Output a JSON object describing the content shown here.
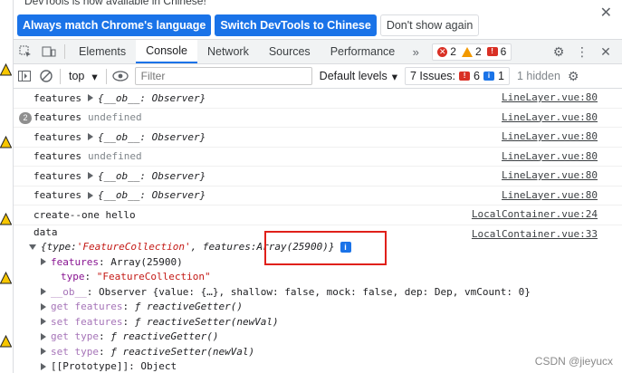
{
  "infobar": {
    "message": "DevTools is now available in Chinese!",
    "buttons": [
      "Always match Chrome's language",
      "Switch DevTools to Chinese",
      "Don't show again"
    ],
    "close_glyph": "✕"
  },
  "tabbar": {
    "tabs": [
      "Elements",
      "Console",
      "Network",
      "Sources",
      "Performance"
    ],
    "active_tab": "Console",
    "more_glyph": "»",
    "error_count": "2",
    "warning_count": "2",
    "issue_count": "6"
  },
  "console_toolbar": {
    "context": "top",
    "filter_placeholder": "Filter",
    "levels_label": "Default levels",
    "issues_label": "7 Issues:",
    "issues_error_count": "6",
    "issues_info_count": "1",
    "hidden_label": "1 hidden"
  },
  "messages": [
    {
      "label": "features",
      "value": "{__ob__: Observer}",
      "source": "LineLayer.vue:80",
      "expandable": true
    },
    {
      "label": "features",
      "value": "undefined",
      "source": "LineLayer.vue:80",
      "repeat": "2",
      "expandable": false
    },
    {
      "label": "features",
      "value": "{__ob__: Observer}",
      "source": "LineLayer.vue:80",
      "expandable": true
    },
    {
      "label": "features",
      "value": "undefined",
      "source": "LineLayer.vue:80",
      "expandable": false
    },
    {
      "label": "features",
      "value": "{__ob__: Observer}",
      "source": "LineLayer.vue:80",
      "expandable": true
    },
    {
      "label": "features",
      "value": "{__ob__: Observer}",
      "source": "LineLayer.vue:80",
      "expandable": true
    },
    {
      "label": "create--one hello",
      "value": "",
      "source": "LocalContainer.vue:24",
      "expandable": false
    }
  ],
  "data_block": {
    "label": "data",
    "source": "LocalContainer.vue:33",
    "summary_prefix": "{type: ",
    "summary_type": "'FeatureCollection'",
    "summary_mid": ", features: ",
    "summary_features": "Array(25900)",
    "summary_suffix": "}",
    "info_glyph": "i",
    "properties": [
      {
        "key": "features",
        "value": "Array(25900)",
        "kind": "expandable"
      },
      {
        "key": "type",
        "value": "\"FeatureCollection\"",
        "kind": "string"
      },
      {
        "key": "__ob__",
        "value": "Observer {value: {…}, shallow: false, mock: false, dep: Dep, vmCount: 0}",
        "kind": "expandable-dim"
      },
      {
        "key": "get features",
        "value": "ƒ reactiveGetter()",
        "kind": "accessor"
      },
      {
        "key": "set features",
        "value": "ƒ reactiveSetter(newVal)",
        "kind": "accessor"
      },
      {
        "key": "get type",
        "value": "ƒ reactiveGetter()",
        "kind": "accessor"
      },
      {
        "key": "set type",
        "value": "ƒ reactiveSetter(newVal)",
        "kind": "accessor"
      },
      {
        "key": "[[Prototype]]",
        "value": "Object",
        "kind": "proto"
      }
    ]
  },
  "watermark": "CSDN @jieyucx",
  "colors": {
    "accent": "#1a73e8",
    "highlight_box": "#e0201a",
    "error": "#d93025",
    "warning": "#f29900"
  }
}
